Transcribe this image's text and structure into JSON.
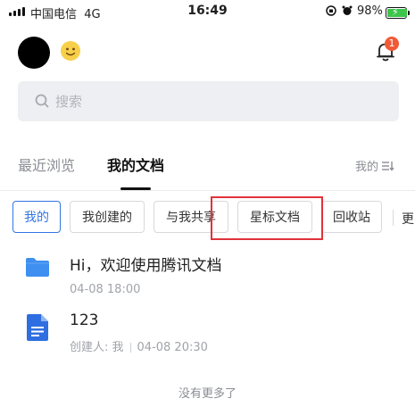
{
  "status_bar": {
    "carrier": "中国电信",
    "network": "4G",
    "time": "16:49",
    "battery_percent": "98%",
    "battery_level": 0.98
  },
  "header": {
    "notification_count": "1"
  },
  "search": {
    "placeholder": "搜索"
  },
  "tabs": {
    "recent": "最近浏览",
    "mine": "我的文档",
    "sort_label": "我的"
  },
  "filters": {
    "items": [
      "我的",
      "我创建的",
      "与我共享",
      "星标文档",
      "回收站"
    ],
    "more": "更"
  },
  "documents": [
    {
      "title": "Hi，欢迎使用腾讯文档",
      "date": "04-08 18:00",
      "type": "folder"
    },
    {
      "title": "123",
      "creator": "创建人: 我",
      "date": "04-08 20:30",
      "type": "doc"
    }
  ],
  "footer": "没有更多了",
  "colors": {
    "accent": "#3275e4",
    "badge": "#f05a37",
    "highlight": "#e0333b",
    "folder": "#3f8ff0",
    "doc": "#2f6ee0"
  }
}
